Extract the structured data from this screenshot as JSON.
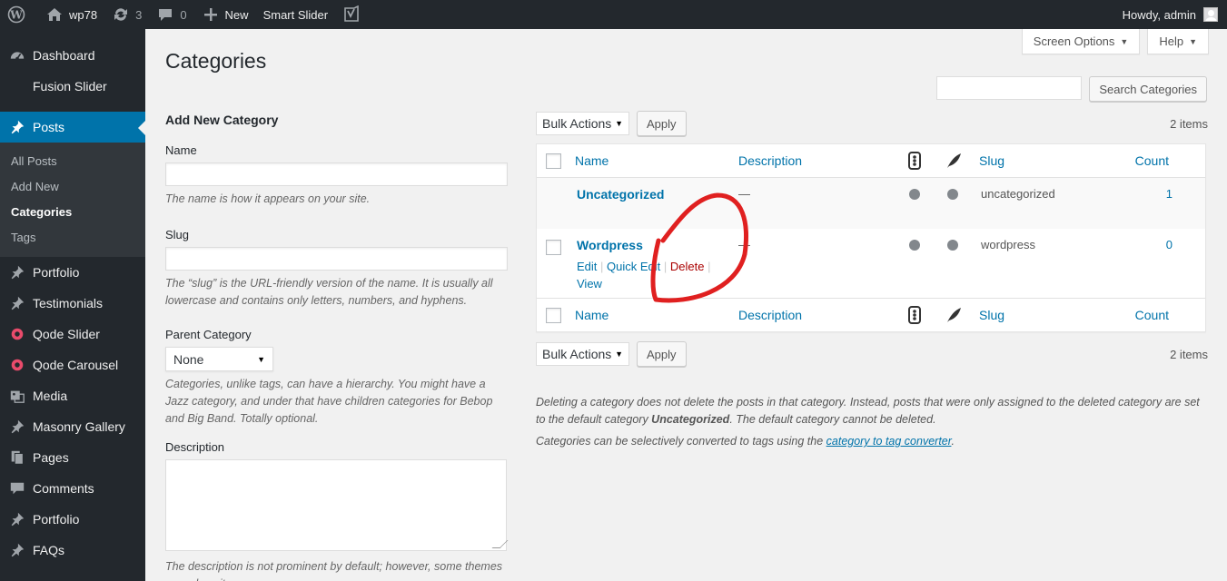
{
  "adminbar": {
    "site_name": "wp78",
    "updates_count": "3",
    "comments_count": "0",
    "new_label": "New",
    "smart_slider_label": "Smart Slider",
    "howdy": "Howdy, admin"
  },
  "sidebar": {
    "items": [
      {
        "label": "Dashboard",
        "icon": "dashboard-icon"
      },
      {
        "label": "Fusion Slider",
        "icon": ""
      },
      {
        "label": "Posts",
        "icon": "pin-icon"
      },
      {
        "label": "Portfolio",
        "icon": "pin-icon"
      },
      {
        "label": "Testimonials",
        "icon": "pin-icon"
      },
      {
        "label": "Qode Slider",
        "icon": "qode-icon"
      },
      {
        "label": "Qode Carousel",
        "icon": "qode-icon"
      },
      {
        "label": "Media",
        "icon": "media-icon"
      },
      {
        "label": "Masonry Gallery",
        "icon": "pin-icon"
      },
      {
        "label": "Pages",
        "icon": "pages-icon"
      },
      {
        "label": "Comments",
        "icon": "comment-icon"
      },
      {
        "label": "Portfolio",
        "icon": "pin-icon"
      },
      {
        "label": "FAQs",
        "icon": "pin-icon"
      }
    ],
    "submenu": [
      "All Posts",
      "Add New",
      "Categories",
      "Tags"
    ]
  },
  "header": {
    "screen_options": "Screen Options",
    "help": "Help",
    "title": "Categories"
  },
  "search": {
    "button": "Search Categories",
    "value": ""
  },
  "form": {
    "heading": "Add New Category",
    "name_label": "Name",
    "name_help": "The name is how it appears on your site.",
    "slug_label": "Slug",
    "slug_help": "The “slug” is the URL-friendly version of the name. It is usually all lowercase and contains only letters, numbers, and hyphens.",
    "parent_label": "Parent Category",
    "parent_value": "None",
    "parent_help": "Categories, unlike tags, can have a hierarchy. You might have a Jazz category, and under that have children categories for Bebop and Big Band. Totally optional.",
    "desc_label": "Description",
    "desc_help": "The description is not prominent by default; however, some themes may show it."
  },
  "list": {
    "bulk_actions": "Bulk Actions",
    "apply": "Apply",
    "items_count": "2 items",
    "columns": {
      "name": "Name",
      "description": "Description",
      "slug": "Slug",
      "count": "Count"
    },
    "rows": [
      {
        "name": "Uncategorized",
        "description": "—",
        "slug": "uncategorized",
        "count": "1"
      },
      {
        "name": "Wordpress",
        "description": "—",
        "slug": "wordpress",
        "count": "0"
      }
    ],
    "row_actions": {
      "edit": "Edit",
      "quick_edit": "Quick Edit",
      "delete": "Delete",
      "view": "View"
    }
  },
  "notes": {
    "line1_a": "Deleting a category does not delete the posts in that category. Instead, posts that were only assigned to the deleted category are set to the default category ",
    "line1_b": "Uncategorized",
    "line1_c": ". The default category cannot be deleted.",
    "line2_a": "Categories can be selectively converted to tags using the ",
    "line2_link": "category to tag converter",
    "line2_b": "."
  },
  "colors": {
    "adminbar_bg": "#23282d",
    "accent": "#0073aa",
    "delete": "#a00000",
    "annotation": "#e02020"
  }
}
